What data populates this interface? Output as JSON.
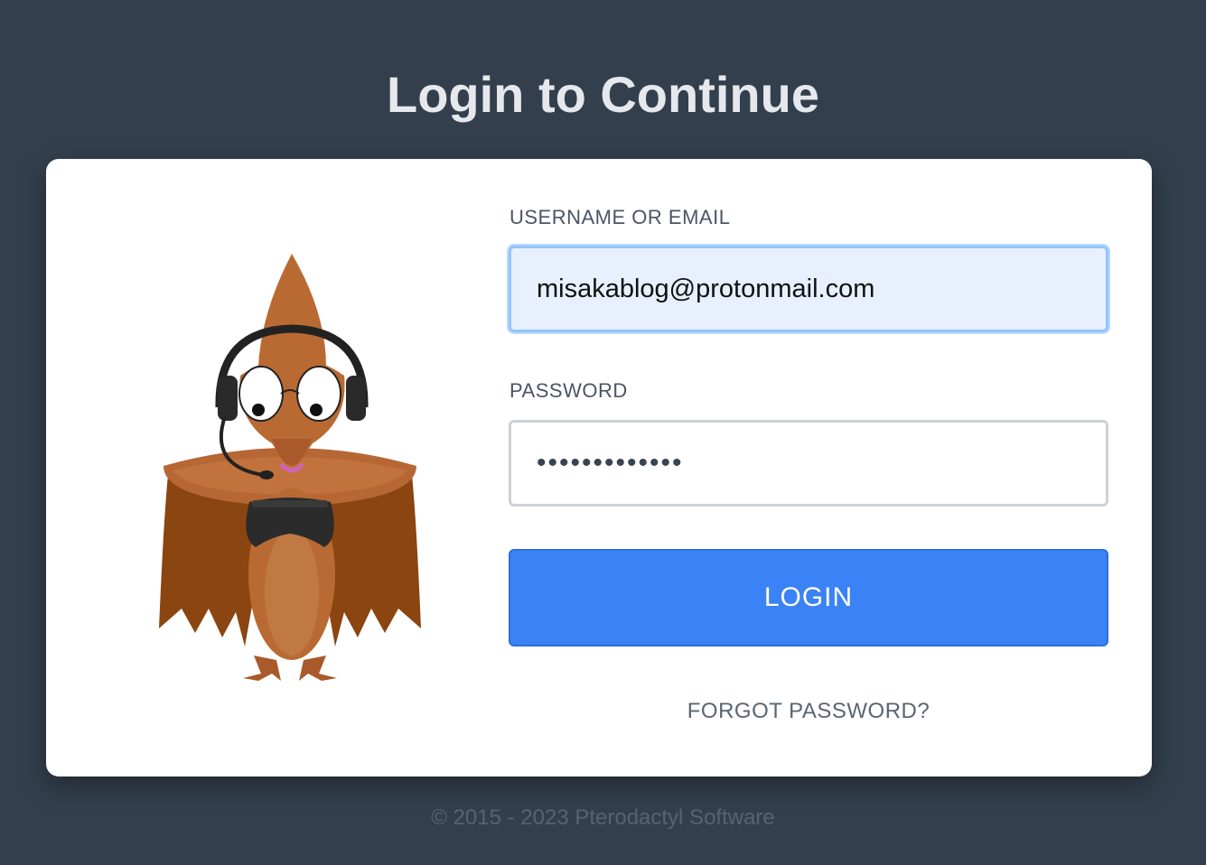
{
  "page": {
    "title": "Login to Continue"
  },
  "form": {
    "username_label": "USERNAME OR EMAIL",
    "username_value": "misakablog@protonmail.com",
    "password_label": "PASSWORD",
    "password_value": "•••••••••••••",
    "login_label": "LOGIN",
    "forgot_label": "FORGOT PASSWORD?"
  },
  "footer": {
    "text": "© 2015 - 2023 Pterodactyl Software"
  },
  "icons": {
    "mascot": "pterodactyl-gamer-mascot"
  },
  "colors": {
    "background": "#333f4d",
    "accent": "#3b82f6",
    "card": "#ffffff",
    "mascot_body": "#b96a33",
    "mascot_wing": "#8a4510"
  }
}
